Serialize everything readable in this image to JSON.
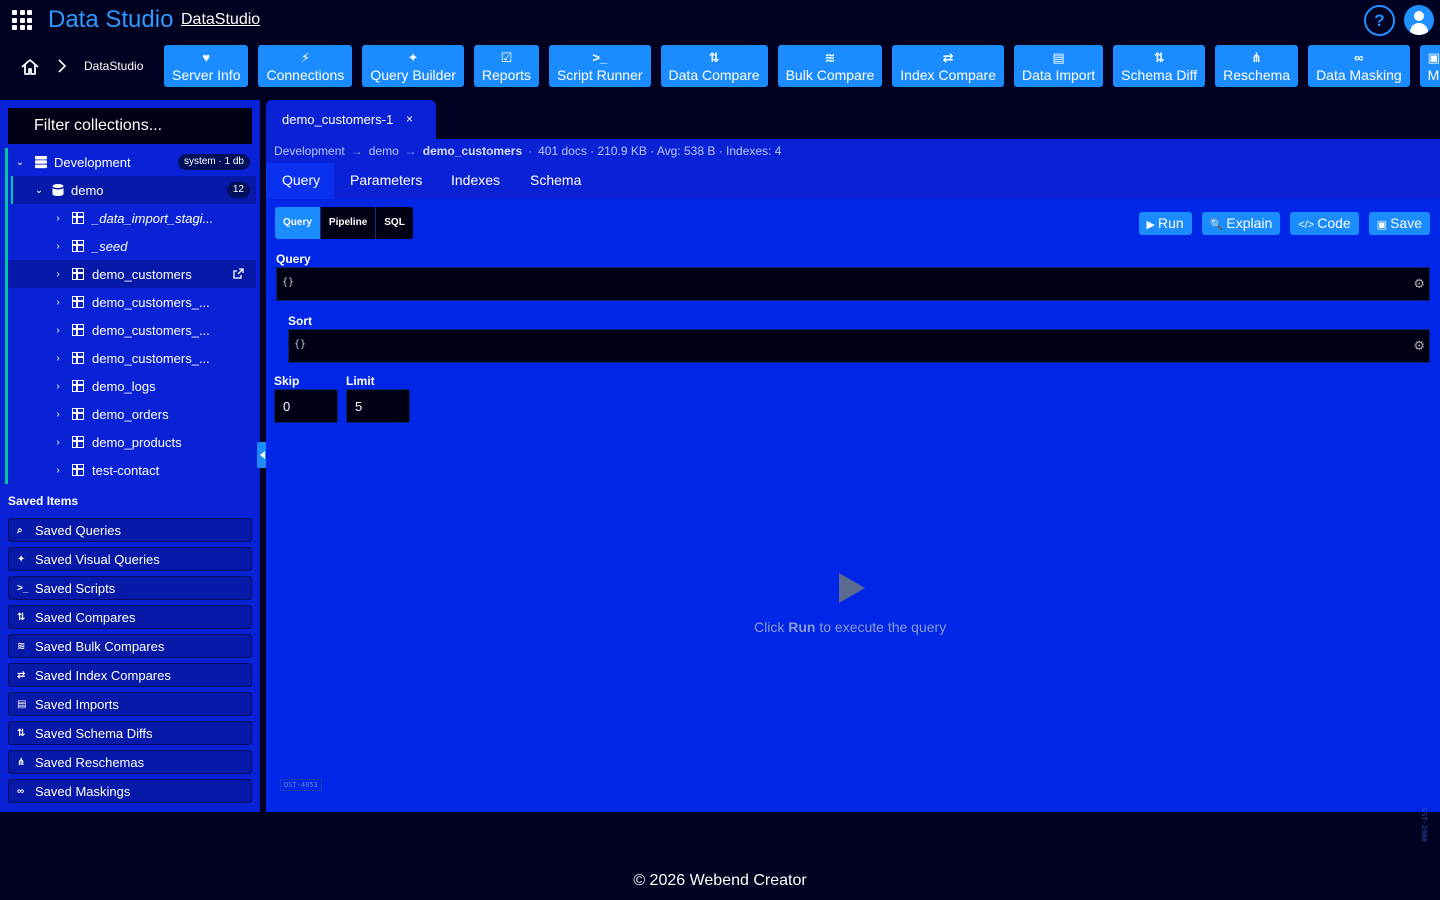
{
  "app": {
    "title": "Data Studio",
    "link": "DataStudio",
    "help": "?"
  },
  "breadcrumb_top": {
    "app": "DataStudio"
  },
  "toolbar": [
    {
      "label": "Server Info",
      "icon": "heart-pulse-icon",
      "glyph": "♥"
    },
    {
      "label": "Connections",
      "icon": "plug-icon",
      "glyph": "⚡"
    },
    {
      "label": "Query Builder",
      "icon": "magic-wand-icon",
      "glyph": "✦"
    },
    {
      "label": "Reports",
      "icon": "clipboard-check-icon",
      "glyph": "☑"
    },
    {
      "label": "Script Runner",
      "icon": "terminal-icon",
      "glyph": ">_"
    },
    {
      "label": "Data Compare",
      "icon": "compare-icon",
      "glyph": "⇅"
    },
    {
      "label": "Bulk Compare",
      "icon": "layers-icon",
      "glyph": "≋"
    },
    {
      "label": "Index Compare",
      "icon": "arrows-exchange-icon",
      "glyph": "⇄"
    },
    {
      "label": "Data Import",
      "icon": "file-import-icon",
      "glyph": "▤"
    },
    {
      "label": "Schema Diff",
      "icon": "diff-icon",
      "glyph": "⇅"
    },
    {
      "label": "Reschema",
      "icon": "diagram-icon",
      "glyph": "⋔"
    },
    {
      "label": "Data Masking",
      "icon": "mask-icon",
      "glyph": "∞"
    },
    {
      "label": "Masking",
      "icon": "save-icon",
      "glyph": "▣"
    }
  ],
  "sidebar": {
    "filter_placeholder": "Filter collections...",
    "connection": {
      "name": "Development",
      "badge": "system · 1 db"
    },
    "database": {
      "name": "demo",
      "count": "12"
    },
    "collections": [
      {
        "name": "_data_import_stagi...",
        "italic": true
      },
      {
        "name": "_seed",
        "italic": true
      },
      {
        "name": "demo_customers",
        "active": true
      },
      {
        "name": "demo_customers_..."
      },
      {
        "name": "demo_customers_..."
      },
      {
        "name": "demo_customers_..."
      },
      {
        "name": "demo_logs"
      },
      {
        "name": "demo_orders"
      },
      {
        "name": "demo_products"
      },
      {
        "name": "test-contact"
      }
    ],
    "saved_title": "Saved Items",
    "saved_items": [
      {
        "label": "Saved Queries",
        "icon": "search-icon",
        "glyph": "⌕"
      },
      {
        "label": "Saved Visual Queries",
        "icon": "magic-wand-icon",
        "glyph": "✦"
      },
      {
        "label": "Saved Scripts",
        "icon": "terminal-icon",
        "glyph": ">_"
      },
      {
        "label": "Saved Compares",
        "icon": "compare-icon",
        "glyph": "⇅"
      },
      {
        "label": "Saved Bulk Compares",
        "icon": "layers-icon",
        "glyph": "≋"
      },
      {
        "label": "Saved Index Compares",
        "icon": "arrows-exchange-icon",
        "glyph": "⇄"
      },
      {
        "label": "Saved Imports",
        "icon": "file-import-icon",
        "glyph": "▤"
      },
      {
        "label": "Saved Schema Diffs",
        "icon": "diff-icon",
        "glyph": "⇅"
      },
      {
        "label": "Saved Reschemas",
        "icon": "diagram-icon",
        "glyph": "⋔"
      },
      {
        "label": "Saved Maskings",
        "icon": "mask-icon",
        "glyph": "∞"
      }
    ]
  },
  "tab": {
    "label": "demo_customers-1",
    "close": "×"
  },
  "info": {
    "connection": "Development",
    "database": "demo",
    "collection": "demo_customers",
    "stats": "401 docs · 210.9 KB · Avg: 538 B · Indexes: 4"
  },
  "subtabs": [
    "Query",
    "Parameters",
    "Indexes",
    "Schema"
  ],
  "modes": [
    "Query",
    "Pipeline",
    "SQL"
  ],
  "actions": [
    {
      "label": "Run",
      "icon": "play-icon",
      "glyph": "▶"
    },
    {
      "label": "Explain",
      "icon": "zoom-icon",
      "glyph": "🔍"
    },
    {
      "label": "Code",
      "icon": "code-icon",
      "glyph": "</>"
    },
    {
      "label": "Save",
      "icon": "save-icon",
      "glyph": "▣"
    }
  ],
  "form": {
    "query_label": "Query",
    "query_value": "{}",
    "sort_label": "Sort",
    "sort_value": "{}",
    "skip_label": "Skip",
    "skip_value": "0",
    "limit_label": "Limit",
    "limit_value": "5"
  },
  "empty": {
    "before": "Click ",
    "bold": "Run",
    "after": " to execute the query"
  },
  "build_tag": "DST-4053",
  "side_tag": "DST-2000",
  "footer": "© 2026 Webend Creator",
  "colors": {
    "accent": "#1a8cff",
    "panel": "#0a22d6",
    "bg": "#000020",
    "tree_guide": "#00c8a0"
  }
}
